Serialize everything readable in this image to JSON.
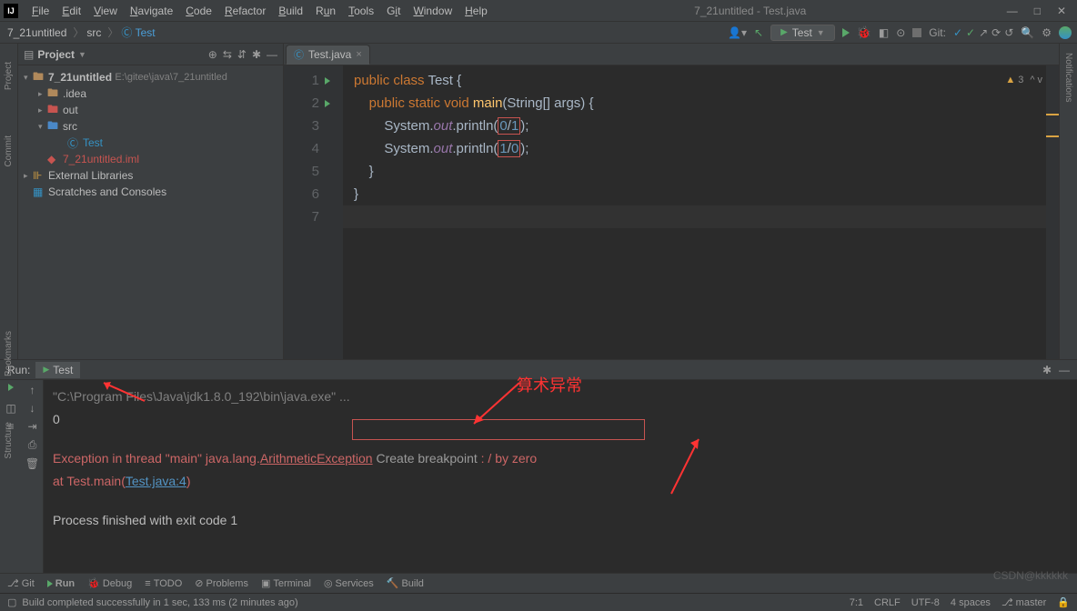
{
  "menu": {
    "items": [
      "File",
      "Edit",
      "View",
      "Navigate",
      "Code",
      "Refactor",
      "Build",
      "Run",
      "Tools",
      "Git",
      "Window",
      "Help"
    ],
    "title": "7_21untitled - Test.java"
  },
  "nav": {
    "crumbs": [
      "7_21untitled",
      "src",
      "Test"
    ],
    "runConfig": "Test",
    "gitLabel": "Git:"
  },
  "projectPanel": {
    "title": "Project",
    "root": {
      "name": "7_21untitled",
      "path": "E:\\gitee\\java\\7_21untitled"
    },
    "children": [
      ".idea",
      "out",
      "src"
    ],
    "srcChild": "Test",
    "iml": "7_21untitled.iml",
    "ext": "External Libraries",
    "scratch": "Scratches and Consoles"
  },
  "editor": {
    "tab": "Test.java",
    "lines": [
      "1",
      "2",
      "3",
      "4",
      "5",
      "6",
      "7"
    ],
    "code": {
      "l1a": "public class ",
      "l1b": "Test ",
      "l1c": "{",
      "l2a": "    public static void ",
      "l2b": "main",
      "l2c": "(String[] args) {",
      "l3a": "        System.",
      "l3b": "out",
      "l3c": ".println(",
      "l3d": "0",
      "l3e": "/",
      "l3f": "1",
      "l3g": ");",
      "l4a": "        System.",
      "l4b": "out",
      "l4c": ".println(",
      "l4d": "1",
      "l4e": "/",
      "l4f": "0",
      "l4g": ");",
      "l5": "    }",
      "l6": "}"
    },
    "warnCount": "3"
  },
  "run": {
    "title": "Run:",
    "tab": "Test",
    "cmd": "\"C:\\Program Files\\Java\\jdk1.8.0_192\\bin\\java.exe\" ...",
    "out0": "0",
    "exc1": "Exception in thread \"main\" java.lang.",
    "exc2": "ArithmeticException",
    "exc3": " Create breakpoint ",
    "exc4": ": / by zero",
    "at1": "    at Test.main(",
    "atlink": "Test.java:4",
    "at2": ")",
    "exit": "Process finished with exit code 1"
  },
  "annot": {
    "label": "算术异常"
  },
  "bottom": {
    "git": "Git",
    "run": "Run",
    "debug": "Debug",
    "todo": "TODO",
    "problems": "Problems",
    "terminal": "Terminal",
    "services": "Services",
    "build": "Build"
  },
  "status": {
    "msg": "Build completed successfully in 1 sec, 133 ms (2 minutes ago)",
    "pos": "7:1",
    "eol": "CRLF",
    "enc": "UTF-8",
    "indent": "4 spaces",
    "branch": "master"
  },
  "sidebars": {
    "left": [
      "Project",
      "Commit",
      "Bookmarks",
      "Structure"
    ],
    "right": "Notifications"
  },
  "watermark": "CSDN@kkkkkk"
}
